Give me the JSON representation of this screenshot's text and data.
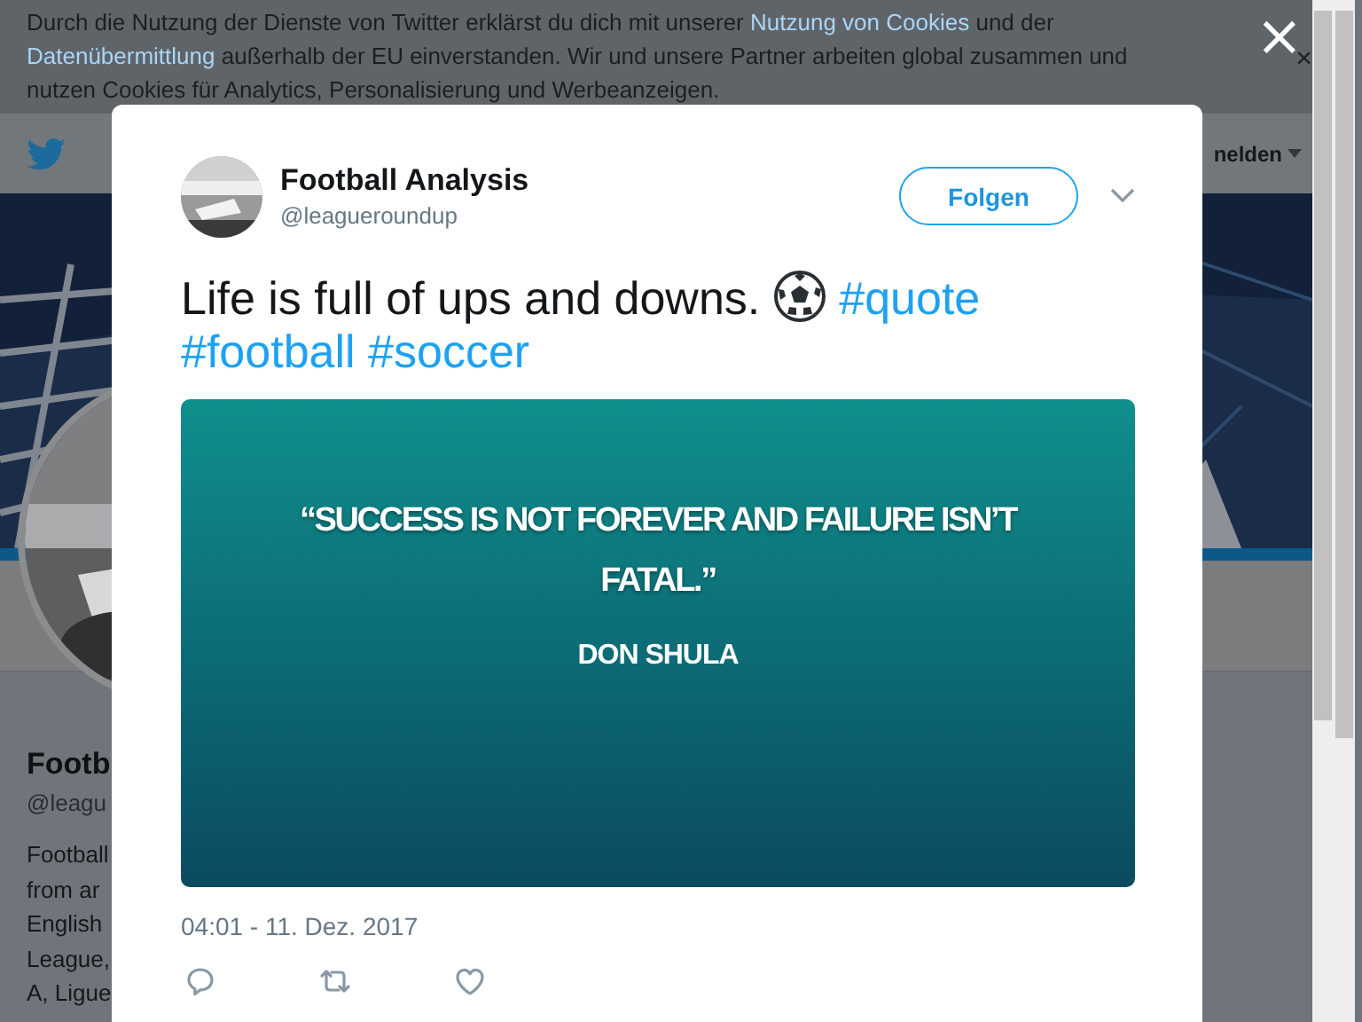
{
  "cookie_banner": {
    "segments": [
      {
        "kind": "text",
        "text": "Durch die Nutzung der Dienste von Twitter erklärst du dich mit unserer"
      },
      {
        "kind": "link",
        "text": "Nutzung von Cookies"
      },
      {
        "kind": "text",
        "text": "und der"
      },
      {
        "kind": "link",
        "text": "Datenübermittlung"
      },
      {
        "kind": "text",
        "text": "außerhalb der EU einverstanden. Wir und unsere Partner arbeiten global zusammen und nutzen Cookies für Analytics, Personalisierung und Werbeanzeigen."
      }
    ],
    "close": "×"
  },
  "nav": {
    "login": "nelden"
  },
  "profile": {
    "name": "Footb",
    "handle": "@leagu",
    "bio_lines": [
      "Football",
      "from ar",
      "English",
      "League,",
      "A, Ligue"
    ]
  },
  "modal": {
    "close": "×",
    "author": {
      "name": "Football Analysis",
      "handle": "@leagueroundup"
    },
    "follow_button": "Folgen",
    "tweet": {
      "parts": [
        {
          "kind": "text",
          "text": "Life is full of ups and downs."
        },
        {
          "kind": "emoji"
        },
        {
          "kind": "hashtag",
          "text": "#quote"
        },
        {
          "kind": "hashtag",
          "text": "#football"
        },
        {
          "kind": "hashtag",
          "text": "#soccer"
        }
      ]
    },
    "quote_card": {
      "quote": "“SUCCESS IS NOT FOREVER AND FAILURE ISN’T FATAL.”",
      "author": "DON SHULA"
    },
    "timestamp": "04:01 - 11. Dez. 2017",
    "actions": [
      {
        "kind": "reply"
      },
      {
        "kind": "retweet"
      },
      {
        "kind": "like"
      }
    ]
  }
}
